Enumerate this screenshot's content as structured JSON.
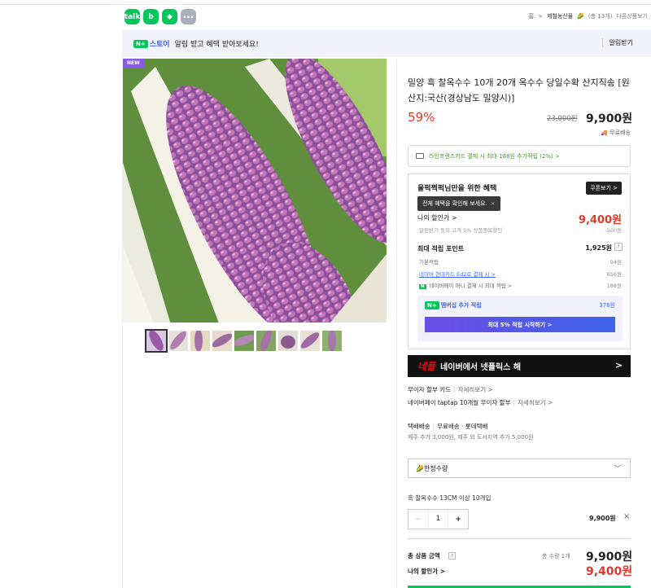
{
  "share": {
    "icons": [
      "talk",
      "band",
      "bookmark"
    ],
    "more": "···"
  },
  "breadcrumb": {
    "home": "홈",
    "sep": ">",
    "category": "제철농산물",
    "extra": "(총 13개)",
    "other": "다른상품보기"
  },
  "banner": {
    "brand_badge": "N+",
    "brand": "스토어",
    "text": "알림 받고 혜택 받아보세요!",
    "right": "알림받기"
  },
  "product": {
    "badge": "NEW",
    "title": "밀양 흑 찰옥수수 10개 20개 옥수수 당일수확 산지직송 [원산지:국산(경상남도 밀양시)]",
    "discount": "59%",
    "original_price": "23,000원",
    "price": "9,900원",
    "shipping": "무료배송"
  },
  "card_benefit": "라인프렌즈카드 결제 시 최대 188원 추가적립 (2%) >",
  "benefit": {
    "title": "울퍽쩍퍽님만을 위한 혜택",
    "coupon_btn": "쿠폰보기 >",
    "tooltip": "전체 혜택을 확인해 보세요.",
    "tooltip_close": "×",
    "my_discount_label": "나의 할인가 >",
    "my_discount_value": "9,400원",
    "discount_sub": "알림받기 동의 고객 5% 상품중복할인",
    "discount_sub_value": "-500원",
    "points_label": "최대 적립 포인트",
    "points_value": "1,925원",
    "points_q": "?",
    "point_rows": [
      {
        "label": "기본적립",
        "value": "94원"
      },
      {
        "label": "네이버 현대카드 Ed2로 결제 시 >",
        "value": "656원"
      },
      {
        "label": "네이버페이 머니 결제 시 최대 적립 >",
        "value": "188원"
      }
    ],
    "member_label": "멤버십 추가 적립",
    "member_value": "376원",
    "member_btn": "최대 5% 적립 시작하기 >",
    "npay": "N"
  },
  "netflix": {
    "logo": "네플",
    "text": "네이버에서 넷플릭스 해",
    "arrow": ">"
  },
  "installment": {
    "row1_label": "무이자 할부 카드",
    "row1_link": "자세히보기 >",
    "row2_label": "네이버페이 taptap 10개월 무이자 할부",
    "row2_link": "자세히보기 >"
  },
  "delivery": {
    "label": "택배배송",
    "type": "무료배송 · 롯데택배",
    "note": "제주 추가 3,000원, 제주 외 도서지역 추가 5,000원"
  },
  "option": {
    "select": "🌽한정수량",
    "chevron": "﹀",
    "name": "흑 찰옥수수 13CM 이상 10개입",
    "qty": "1",
    "minus": "−",
    "plus": "+",
    "line_price": "9,900원",
    "remove": "×"
  },
  "total": {
    "label": "총 상품 금액",
    "q": "?",
    "count": "총 수량 1개",
    "value": "9,900원",
    "my_label": "나의 할인가 >",
    "my_value": "9,400원"
  }
}
